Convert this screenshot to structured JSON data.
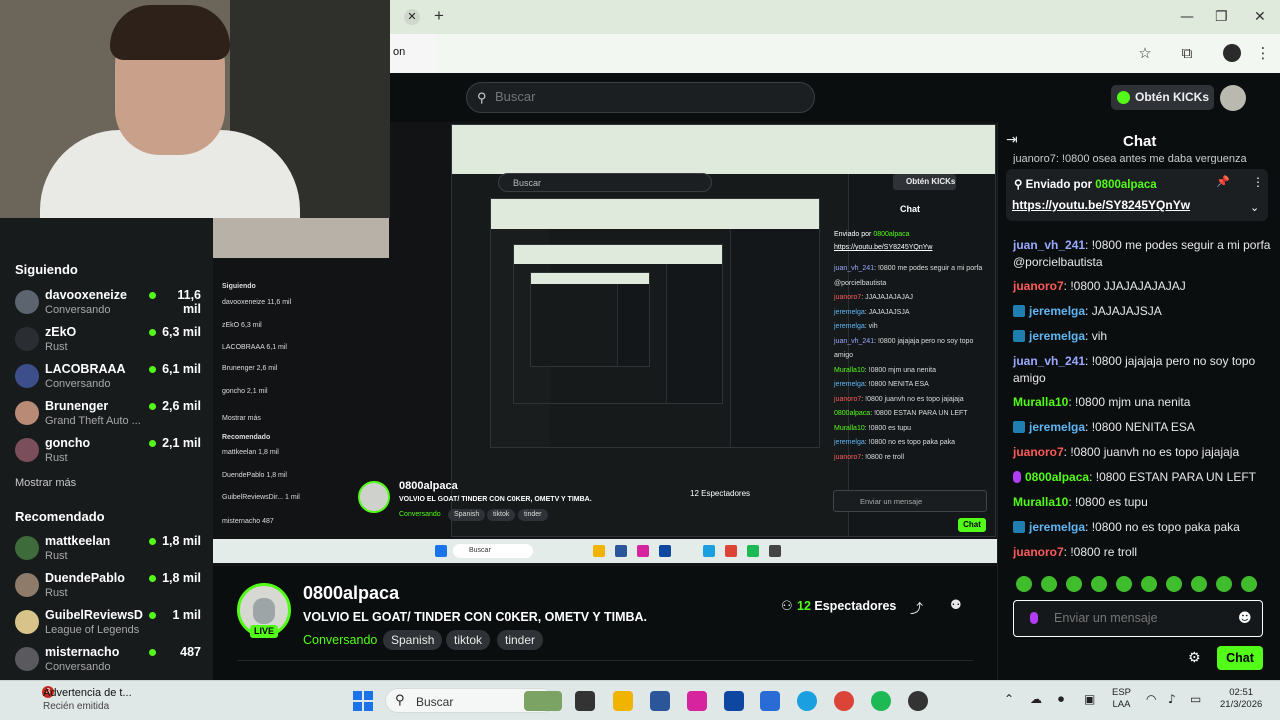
{
  "browser": {
    "tab_close_glyph": "✕",
    "new_tab_glyph": "+",
    "dropdown_text": "on",
    "window_controls": [
      "—",
      "❐",
      "✕"
    ],
    "toolbar_icons": [
      "star-icon",
      "extensions-icon",
      "profile-icon",
      "menu-icon"
    ]
  },
  "header": {
    "search_placeholder": "Buscar",
    "obten_label": "Obtén KICKs"
  },
  "sidebar": {
    "following_title": "Siguiendo",
    "following": [
      {
        "name": "davooxeneize",
        "category": "Conversando",
        "viewers": "11,6 mil",
        "color": "#5c6470"
      },
      {
        "name": "zEkO",
        "category": "Rust",
        "viewers": "6,3 mil",
        "color": "#2a2d31"
      },
      {
        "name": "LACOBRAAA",
        "category": "Conversando",
        "viewers": "6,1 mil",
        "color": "#3c4f8a"
      },
      {
        "name": "Brunenger",
        "category": "Grand Theft Auto ...",
        "viewers": "2,6 mil",
        "color": "#b98a76"
      },
      {
        "name": "goncho",
        "category": "Rust",
        "viewers": "2,1 mil",
        "color": "#7a4e5a"
      }
    ],
    "show_more": "Mostrar más",
    "recommended_title": "Recomendado",
    "recommended": [
      {
        "name": "mattkeelan",
        "category": "Rust",
        "viewers": "1,8 mil",
        "color": "#3d6b3a"
      },
      {
        "name": "DuendePablo",
        "category": "Rust",
        "viewers": "1,8 mil",
        "color": "#8e7b6a"
      },
      {
        "name": "GuibelReviewsDir...",
        "category": "League of Legends",
        "viewers": "1 mil",
        "color": "#d8c48a"
      },
      {
        "name": "misternacho",
        "category": "Conversando",
        "viewers": "487",
        "color": "#5a5a5e"
      }
    ]
  },
  "stream": {
    "streamer": "0800alpaca",
    "live": "LIVE",
    "title": "VOLVIO EL GOAT/ TINDER CON C0KER, OMETV Y TIMBA.",
    "category": "Conversando",
    "tags": [
      "Spanish",
      "tiktok",
      "tinder"
    ],
    "viewers_count": "12",
    "viewers_label": "Espectadores"
  },
  "inner": {
    "search": "Buscar",
    "obten": "Obtén KICKs",
    "chat_title": "Chat",
    "streamer": "0800alpaca",
    "title": "VOLVIO EL GOAT/ TINDER CON C0KER, OMETV Y TIMBA.",
    "category": "Conversando",
    "tags": [
      "Spanish",
      "tiktok",
      "tinder"
    ],
    "viewers": "12 Espectadores",
    "input": "Enviar un mensaje",
    "chat_btn": "Chat",
    "pinned_by": "Enviado por",
    "pinned_user": "0800alpaca",
    "pinned_link": "https://youtu.be/SY8245YQnYw",
    "taskbar_search": "Buscar",
    "chat_lines": [
      {
        "u": "juan_vh_241",
        "t": ": !0800 me podes seguir a mi porfa",
        "c": "#9aa8ff"
      },
      {
        "u": "",
        "t": "@porcielbautista",
        "c": "#ccc"
      },
      {
        "u": "juanoro7",
        "t": ": JJAJAJAJAJAJ",
        "c": "#ff5a5a"
      },
      {
        "u": "jeremelga",
        "t": ": JAJAJAJSJA",
        "c": "#5fb6f5"
      },
      {
        "u": "jeremelga",
        "t": ": vih",
        "c": "#5fb6f5"
      },
      {
        "u": "juan_vh_241",
        "t": ": !0800 jajajaja pero no soy topo",
        "c": "#9aa8ff"
      },
      {
        "u": "",
        "t": "amigo",
        "c": "#ccc"
      },
      {
        "u": "Muralla10",
        "t": ": !0800 mjm una nenita",
        "c": "#53fc18"
      },
      {
        "u": "jeremelga",
        "t": ": !0800 NENITA ESA",
        "c": "#5fb6f5"
      },
      {
        "u": "juanoro7",
        "t": ": !0800 juanvh no es topo jajajaja",
        "c": "#ff5a5a"
      },
      {
        "u": "0800alpaca",
        "t": ": !0800 ESTAN PARA UN LEFT",
        "c": "#53fc18"
      },
      {
        "u": "Muralla10",
        "t": ": !0800 es tupu",
        "c": "#53fc18"
      },
      {
        "u": "jeremelga",
        "t": ": !0800 no es topo paka paka",
        "c": "#5fb6f5"
      },
      {
        "u": "juanoro7",
        "t": ": !0800 re troll",
        "c": "#ff5a5a"
      }
    ],
    "sidebar_lines": [
      {
        "t": "Siguiendo",
        "b": true
      },
      {
        "t": "davooxeneize   11,6 mil",
        "b": false
      },
      {
        "t": "zEkO   6,3 mil",
        "b": false
      },
      {
        "t": "LACOBRAAA   6,1 mil",
        "b": false
      },
      {
        "t": "Brunenger   2,6 mil",
        "b": false
      },
      {
        "t": "goncho   2,1 mil",
        "b": false
      },
      {
        "t": "Mostrar más",
        "b": false
      },
      {
        "t": "Recomendado",
        "b": true
      },
      {
        "t": "mattkeelan   1,8 mil",
        "b": false
      },
      {
        "t": "DuendePablo   1,8 mil",
        "b": false
      },
      {
        "t": "GuibelReviewsDir...   1 mil",
        "b": false
      },
      {
        "t": "misternacho   487",
        "b": false
      }
    ]
  },
  "chat": {
    "title": "Chat",
    "cut_line": "juanoro7: !0800 osea antes me daba verguenza",
    "pinned_prefix": "Enviado por",
    "pinned_user": "0800alpaca",
    "pinned_link": "https://youtu.be/SY8245YQnYw",
    "messages": [
      {
        "user": "juan_vh_241",
        "text": ": !0800 me podes seguir a mi porfa @porcielbautista",
        "color": "#9aa8ff",
        "badge": false
      },
      {
        "user": "juanoro7",
        "text": ": !0800 JJAJAJAJAJAJ",
        "color": "#ff5a5a",
        "badge": false
      },
      {
        "user": "jeremelga",
        "text": ": JAJAJAJSJA",
        "color": "#5fb6f5",
        "badge": true
      },
      {
        "user": "jeremelga",
        "text": ": vih",
        "color": "#5fb6f5",
        "badge": true
      },
      {
        "user": "juan_vh_241",
        "text": ": !0800 jajajaja pero no soy topo amigo",
        "color": "#9aa8ff",
        "badge": false
      },
      {
        "user": "Muralla10",
        "text": ": !0800 mjm una nenita",
        "color": "#53fc18",
        "badge": false
      },
      {
        "user": "jeremelga",
        "text": ": !0800 NENITA ESA",
        "color": "#5fb6f5",
        "badge": true
      },
      {
        "user": "juanoro7",
        "text": ": !0800 juanvh no es topo jajajaja",
        "color": "#ff5a5a",
        "badge": false
      },
      {
        "user": "0800alpaca",
        "text": ": !0800 ESTAN PARA UN LEFT",
        "color": "#53fc18",
        "badge": false,
        "mic": true
      },
      {
        "user": "Muralla10",
        "text": ": !0800 es tupu",
        "color": "#53fc18",
        "badge": false
      },
      {
        "user": "jeremelga",
        "text": ": !0800 no es topo paka paka",
        "color": "#5fb6f5",
        "badge": true
      },
      {
        "user": "juanoro7",
        "text": ": !0800 re troll",
        "color": "#ff5a5a",
        "badge": false
      }
    ],
    "input_placeholder": "Enviar un mensaje",
    "send_label": "Chat"
  },
  "taskbar": {
    "notification_title": "Advertencia de t...",
    "notification_sub": "Recién emitida",
    "notification_count": "3",
    "search_label": "Buscar",
    "lang_1": "ESP",
    "lang_2": "LAA",
    "time": "02:51",
    "date": "21/3/2026"
  },
  "colors": {
    "accent": "#53fc18",
    "bg": "#0b0e0f",
    "panel": "#181b1c"
  }
}
